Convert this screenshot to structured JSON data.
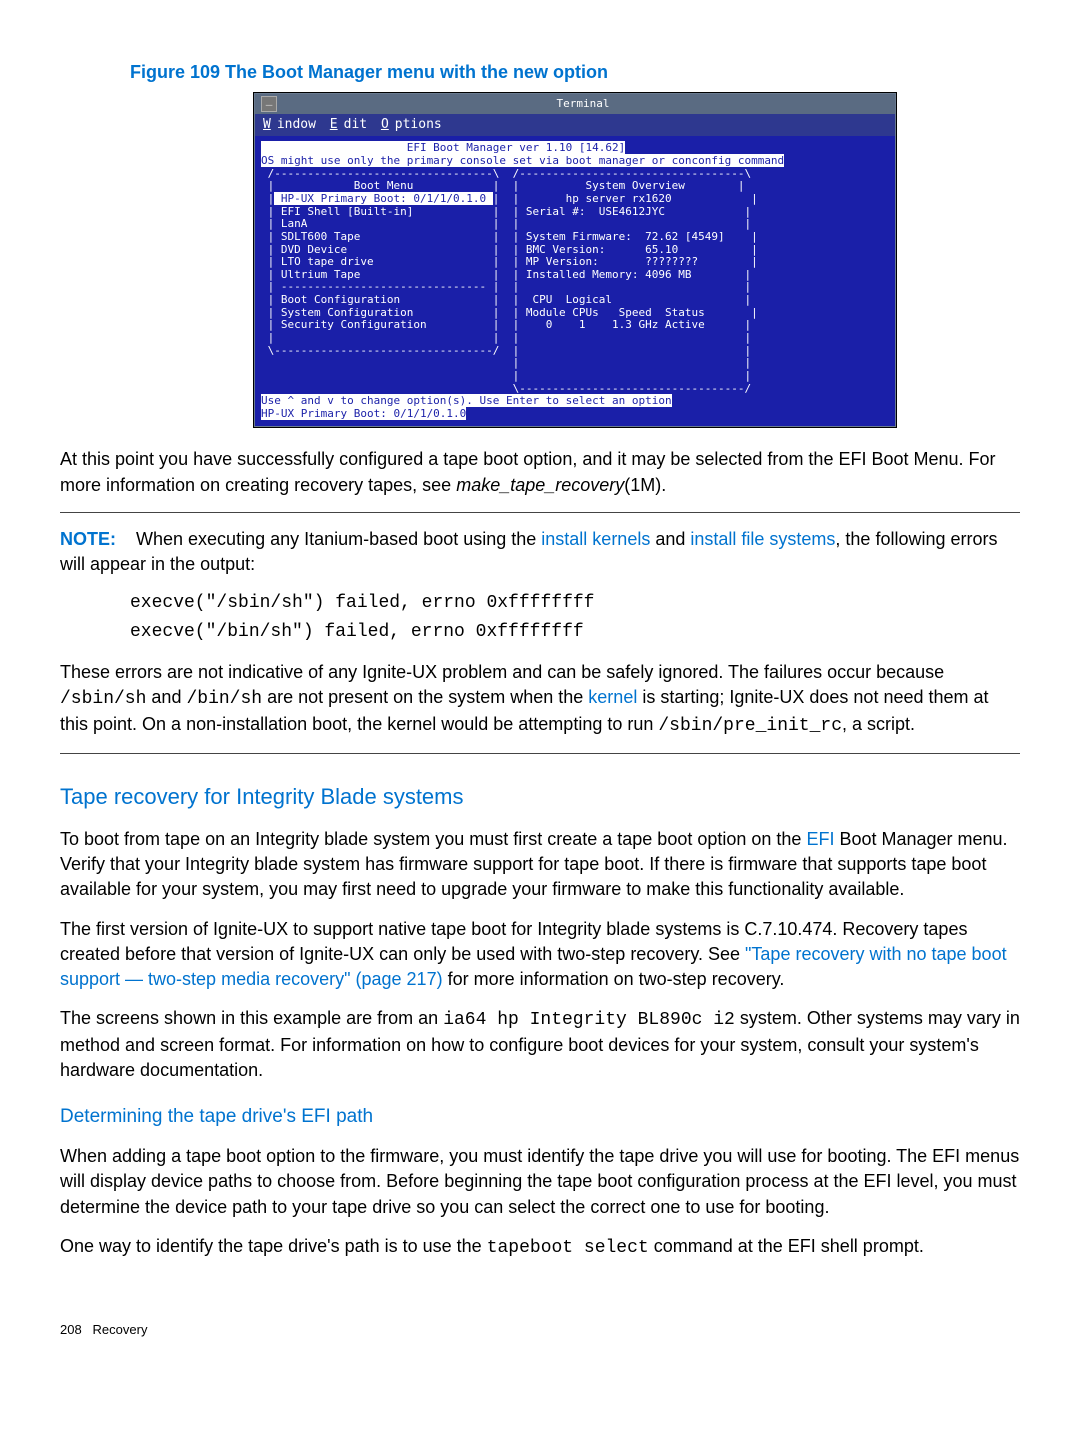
{
  "figure": {
    "caption": "Figure 109 The Boot Manager menu with the new option"
  },
  "terminal": {
    "window_icon": "—",
    "title": "Terminal",
    "menu": {
      "w": "W",
      "window": "indow  ",
      "e": "E",
      "edit": "dit  ",
      "o": "O",
      "options": "ptions"
    },
    "banner1": "                      EFI Boot Manager ver 1.10 [14.62]",
    "banner2": "OS might use only the primary console set via boot manager or conconfig command",
    "boot_menu_label": "            Boot Menu            ",
    "left_selected": " HP-UX Primary Boot: 0/1/1/0.1.0 ",
    "left_items": [
      " EFI Shell [Built-in]",
      " LanA",
      " SDLT600 Tape",
      " DVD Device",
      " LTO tape drive",
      " Ultrium Tape"
    ],
    "left_items2": [
      " Boot Configuration",
      " System Configuration",
      " Security Configuration"
    ],
    "right_title": "          System Overview",
    "right_lines": [
      "       hp server rx1620",
      " Serial #:  USE4612JYC",
      "",
      " System Firmware:  72.62 [4549]",
      " BMC Version:      65.10",
      " MP Version:       ????????",
      " Installed Memory: 4096 MB",
      "",
      "  CPU  Logical",
      " Module CPUs   Speed  Status",
      "    0    1    1.3 GHz Active"
    ],
    "hint1": "Use ^ and v to change option(s). Use Enter to select an option",
    "hint2": "HP-UX Primary Boot: 0/1/1/0.1.0"
  },
  "body": {
    "p1a": "At this point you have successfully configured a tape boot option, and it may be selected from the EFI Boot Menu. For more information on creating recovery tapes, see ",
    "p1b": "make_tape_recovery",
    "p1c": "(1M).",
    "note_label": "NOTE:",
    "note_a": "When executing any Itanium-based boot using the ",
    "note_link1": "install kernels",
    "note_b": " and ",
    "note_link2": "install file systems",
    "note_c": ", the following errors will appear in the output:",
    "err1": "execve(\"/sbin/sh\") failed, errno 0xffffffff",
    "err2": "execve(\"/bin/sh\") failed, errno 0xffffffff",
    "p2a": "These errors are not indicative of any Ignite-UX problem and can be safely ignored. The failures occur because ",
    "p2m1": "/sbin/sh",
    "p2b": " and ",
    "p2m2": "/bin/sh",
    "p2c": " are not present on the system when the ",
    "p2link": "kernel",
    "p2d": " is starting; Ignite-UX does not need them at this point. On a non-installation boot, the kernel would be attempting to run ",
    "p2m3": "/sbin/pre_init_rc",
    "p2e": ", a script.",
    "h2": "Tape recovery for Integrity Blade systems",
    "p3a": "To boot from tape on an Integrity blade system you must first create a tape boot option on the ",
    "p3link": "EFI",
    "p3b": " Boot Manager menu. Verify that your Integrity blade system has firmware support for tape boot. If there is firmware that supports tape boot available for your system, you may first need to upgrade your firmware to make this functionality available.",
    "p4a": "The first version of Ignite-UX to support native tape boot for Integrity blade systems is C.7.10.474. Recovery tapes created before that version of Ignite-UX can only be used with two-step recovery. See ",
    "p4link": "\"Tape recovery with no tape boot support — two-step media recovery\" (page 217)",
    "p4b": " for more information on two-step recovery.",
    "p5a": "The screens shown in this example are from an ",
    "p5m": "ia64 hp Integrity BL890c i2",
    "p5b": " system. Other systems may vary in method and screen format. For information on how to configure boot devices for your system, consult your system's hardware documentation.",
    "h3": "Determining the tape drive's EFI path",
    "p6": "When adding a tape boot option to the firmware, you must identify the tape drive you will use for booting. The EFI menus will display device paths to choose from. Before beginning the tape boot configuration process at the EFI level, you must determine the device path to your tape drive so you can select the correct one to use for booting.",
    "p7a": "One way to identify the tape drive's path is to use the ",
    "p7m": "tapeboot select",
    "p7b": " command at the EFI shell prompt."
  },
  "footer": {
    "page": "208",
    "section": "Recovery"
  }
}
